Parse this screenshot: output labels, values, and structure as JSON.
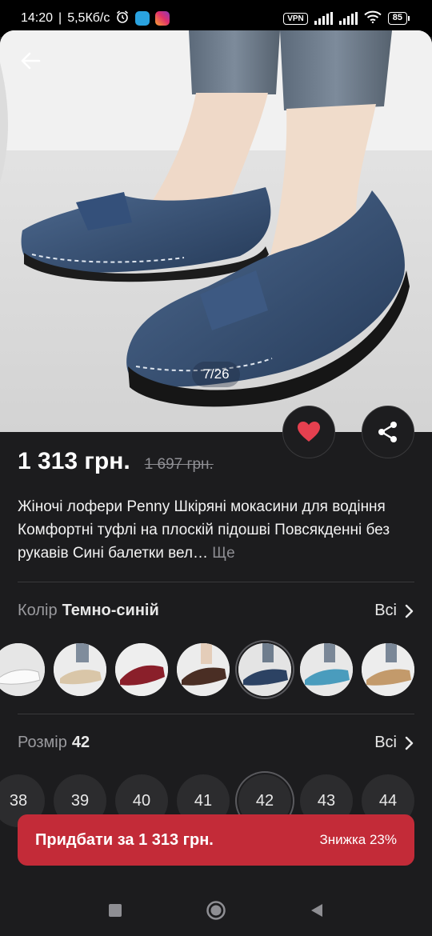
{
  "status_bar": {
    "time": "14:20",
    "speed": "5,5Кб/с",
    "vpn": "VPN",
    "battery": "85",
    "icons": [
      "alarm-icon",
      "telegram-icon",
      "instagram-icon",
      "signal-icon",
      "wifi-icon",
      "battery-icon"
    ]
  },
  "gallery": {
    "counter": "7/26"
  },
  "product": {
    "price": "1 313 грн.",
    "old_price": "1 697 грн.",
    "title": "Жіночі лофери Penny Шкіряні мокасини для водіння Комфортні туфлі на плоскій підошві Повсякденні без рукавів Сині балетки вел…",
    "more": "Ще"
  },
  "color_option": {
    "label": "Колір",
    "value": "Темно-синій",
    "all": "Всі",
    "swatches": [
      {
        "name": "white"
      },
      {
        "name": "beige"
      },
      {
        "name": "burgundy"
      },
      {
        "name": "brown"
      },
      {
        "name": "navy",
        "selected": true
      },
      {
        "name": "light-blue"
      },
      {
        "name": "tan"
      }
    ]
  },
  "size_option": {
    "label": "Розмір",
    "value": "42",
    "all": "Всі",
    "sizes": [
      "38",
      "39",
      "40",
      "41",
      "42",
      "43",
      "44"
    ],
    "selected": "42"
  },
  "buy": {
    "label": "Придбати за 1 313 грн.",
    "discount": "Знижка 23%"
  },
  "colors": {
    "accent": "#c32b38",
    "background": "#1c1c1e",
    "favorite": "#e5404f"
  }
}
